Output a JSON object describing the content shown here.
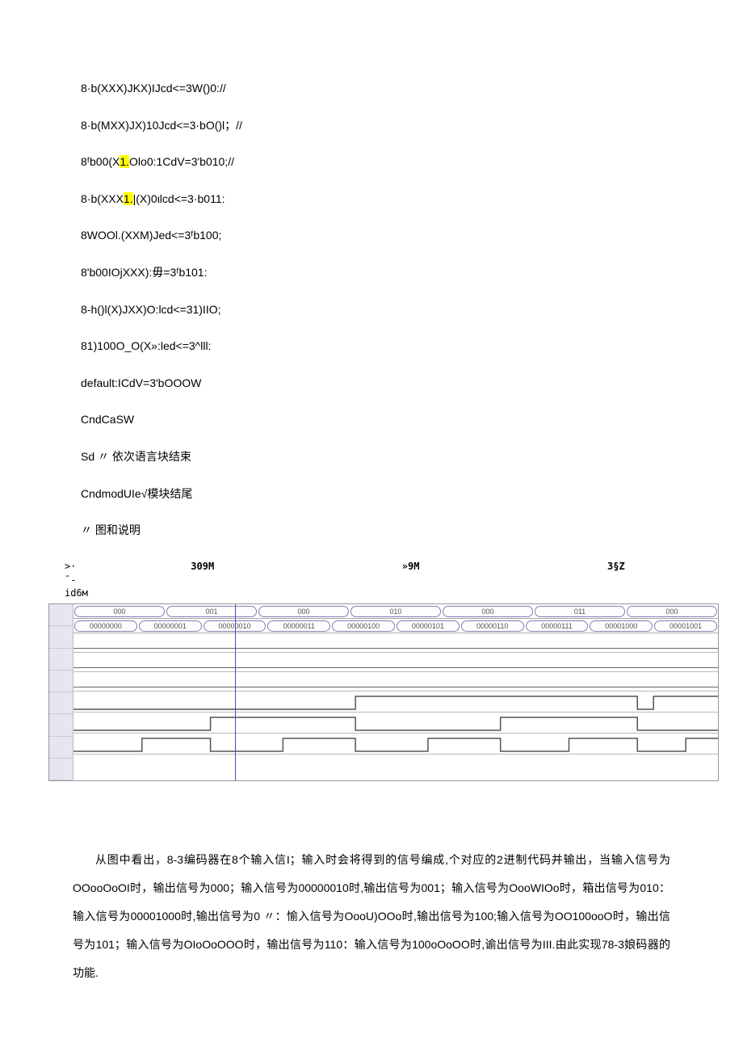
{
  "code": {
    "lines": [
      {
        "pre": "8·b(XXX)JKX)IJcd<=3W()0://",
        "hl": "",
        "post": ""
      },
      {
        "pre": "8·b(MXX)JX)10Jcd<=3·bO()l；//",
        "hl": "",
        "post": ""
      },
      {
        "pre": "8ᶠb00(X",
        "hl": "1.",
        "post": "Olo0:1CdV=3'b010;//"
      },
      {
        "pre": "8·b(XXX",
        "hl": "1.",
        "post": "|(X)0ιlcd<=3·b011:"
      },
      {
        "pre": "8WOOl.(XXM)Jed<=3ᶠb100;",
        "hl": "",
        "post": ""
      },
      {
        "pre": "8'b00IOjXXX):毋=3ᶠb101:",
        "hl": "",
        "post": ""
      },
      {
        "pre": "8-h()l(X)JXX)O:lcd<=31)IIO;",
        "hl": "",
        "post": ""
      },
      {
        "pre": "81)100O_O(X»:led<=3^lll:",
        "hl": "",
        "post": ""
      },
      {
        "pre": "default:ICdV=3'bOOOW",
        "hl": "",
        "post": ""
      },
      {
        "pre": "CndCaSW",
        "hl": "",
        "post": ""
      },
      {
        "pre": "Sd 〃 依次语言块结束",
        "hl": "",
        "post": ""
      },
      {
        "pre": "CndmodUIe√模块结尾",
        "hl": "",
        "post": ""
      },
      {
        "pre": "〃 图和说明",
        "hl": "",
        "post": ""
      }
    ]
  },
  "timeline": {
    "left_top": ">·",
    "left_bottom": "¯-id6м",
    "axis": [
      "309M",
      "»9M",
      "3§Z"
    ],
    "row1": [
      "000",
      "001",
      "000",
      "010",
      "000",
      "011",
      "000"
    ],
    "row2": [
      "00000000",
      "00000001",
      "00000010",
      "00000011",
      "00000100",
      "00000101",
      "00000110",
      "00000111",
      "00001000",
      "00001001"
    ]
  },
  "explanation": "从图中看出，8-3编码器在8个输入信I；输入时会将得到的信号编成,个对应的2进制代码并输出，当输入信号为OOooOoOI时，输出信号为000；输入信号为00000010时,输出信号为001；输入信号为OooWIOo时，箱出信号为010：输入信号为00001000时,输出信号为0 〃：愉入信号为OooU)OOo时,输出信号为100;输入信号为OO100ooO时，输出信号为101；输入信号为OIoOoOOO时，输出信号为110：输入信号为100oOoOO时,谕出信号为III.由此实现78-3娘码器的功能."
}
